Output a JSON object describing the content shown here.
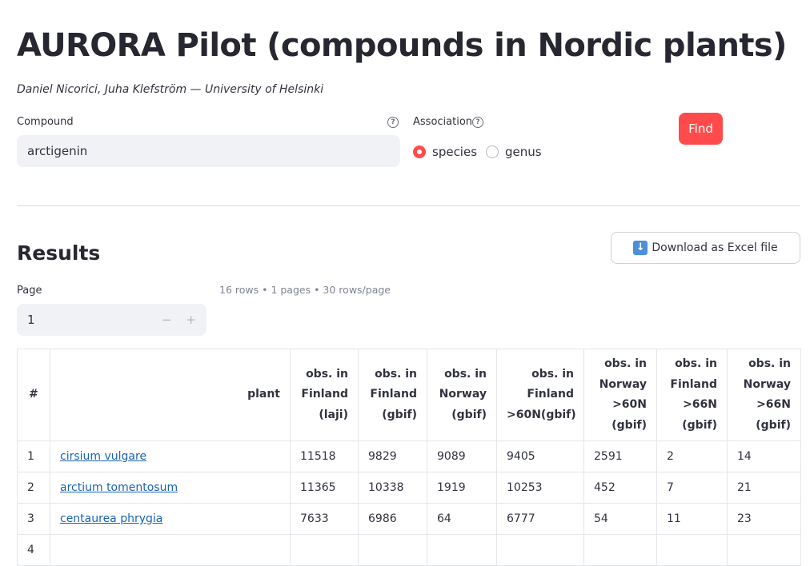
{
  "header": {
    "title": "AURORA Pilot (compounds in Nordic plants)",
    "authors": "Daniel Nicorici, Juha Klefström — University of Helsinki"
  },
  "form": {
    "compound_label": "Compound",
    "compound_value": "arctigenin",
    "association_label": "Association",
    "options": [
      "species",
      "genus"
    ],
    "selected": "species",
    "find_label": "Find",
    "help_glyph": "?"
  },
  "results": {
    "heading": "Results",
    "download_label": "Download as Excel file",
    "page_label": "Page",
    "page_value": "1",
    "stepper_minus": "−",
    "stepper_plus": "+",
    "meta": "16 rows • 1 pages • 30 rows/page",
    "columns": [
      "#",
      "plant",
      "obs. in Finland (laji)",
      "obs. in Finland (gbif)",
      "obs. in Norway (gbif)",
      "obs. in Finland >60N(gbif)",
      "obs. in Norway >60N (gbif)",
      "obs. in Finland >66N (gbif)",
      "obs. in Norway >66N (gbif)"
    ],
    "rows": [
      [
        "1",
        "cirsium vulgare",
        "11518",
        "9829",
        "9089",
        "9405",
        "2591",
        "2",
        "14"
      ],
      [
        "2",
        "arctium tomentosum",
        "11365",
        "10338",
        "1919",
        "10253",
        "452",
        "7",
        "21"
      ],
      [
        "3",
        "centaurea phrygia",
        "7633",
        "6986",
        "64",
        "6777",
        "54",
        "11",
        "23"
      ],
      [
        "4",
        "",
        "",
        "",
        "",
        "",
        "",
        "",
        ""
      ]
    ]
  },
  "colors": {
    "accent": "#ff4b4b",
    "link": "#1a63b8",
    "input_bg": "#f0f2f6"
  },
  "icons": {
    "help": "question-circle-icon",
    "download": "down-arrow-icon"
  }
}
